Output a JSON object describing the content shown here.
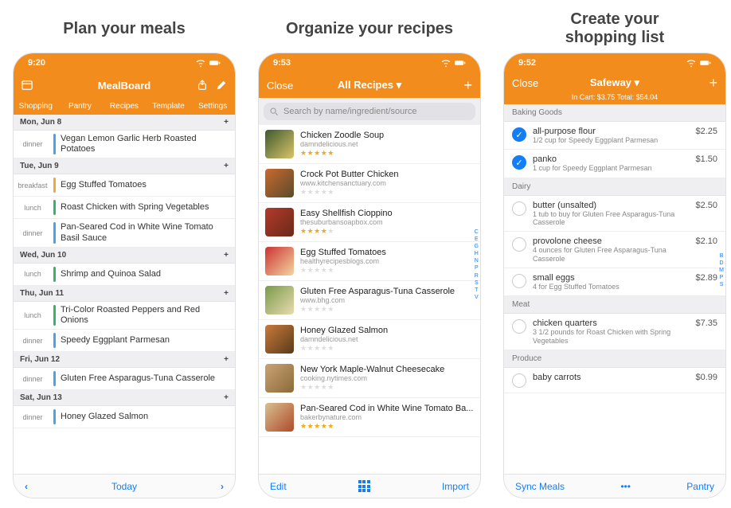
{
  "captions": {
    "plan": "Plan your meals",
    "recipes": "Organize your recipes",
    "shopping": "Create your\nshopping list"
  },
  "status": {
    "plan_time": "9:20",
    "recipes_time": "9:53",
    "shopping_time": "9:52"
  },
  "plan": {
    "nav_title": "MealBoard",
    "tabs": [
      "Shopping",
      "Pantry",
      "Recipes",
      "Template",
      "Settings"
    ],
    "days": [
      {
        "label": "Mon, Jun 8",
        "meals": [
          {
            "slot": "dinner",
            "color": "#4aa3e8",
            "title": "Vegan Lemon Garlic Herb Roasted Potatoes"
          }
        ]
      },
      {
        "label": "Tue, Jun 9",
        "meals": [
          {
            "slot": "breakfast",
            "color": "#f0a83a",
            "title": "Egg Stuffed Tomatoes"
          },
          {
            "slot": "lunch",
            "color": "#39b36a",
            "title": "Roast Chicken with Spring Vegetables"
          },
          {
            "slot": "dinner",
            "color": "#4aa3e8",
            "title": "Pan-Seared Cod in White Wine Tomato Basil Sauce"
          }
        ]
      },
      {
        "label": "Wed, Jun 10",
        "meals": [
          {
            "slot": "lunch",
            "color": "#39b36a",
            "title": "Shrimp and Quinoa Salad"
          }
        ]
      },
      {
        "label": "Thu, Jun 11",
        "meals": [
          {
            "slot": "lunch",
            "color": "#39b36a",
            "title": "Tri-Color Roasted Peppers and Red Onions"
          },
          {
            "slot": "dinner",
            "color": "#4aa3e8",
            "title": "Speedy Eggplant Parmesan"
          }
        ]
      },
      {
        "label": "Fri, Jun 12",
        "meals": [
          {
            "slot": "dinner",
            "color": "#4aa3e8",
            "title": "Gluten Free Asparagus-Tuna Casserole"
          }
        ]
      },
      {
        "label": "Sat, Jun 13",
        "meals": [
          {
            "slot": "dinner",
            "color": "#4aa3e8",
            "title": "Honey Glazed Salmon"
          }
        ]
      }
    ],
    "bottom": {
      "prev": "‹",
      "today": "Today",
      "next": "›"
    }
  },
  "recipes": {
    "close": "Close",
    "title": "All Recipes ▾",
    "plus": "+",
    "search_placeholder": "Search by name/ingredient/source",
    "items": [
      {
        "title": "Chicken Zoodle Soup",
        "source": "damndelicious.net",
        "stars": 5,
        "thumb": "linear-gradient(135deg,#3e5a2f,#d9c46a)"
      },
      {
        "title": "Crock Pot Butter Chicken",
        "source": "www.kitchensanctuary.com",
        "stars": 0,
        "thumb": "linear-gradient(135deg,#c96a2d,#5a4a2d)"
      },
      {
        "title": "Easy Shellfish Cioppino",
        "source": "thesuburbansoapbox.com",
        "stars": 4,
        "thumb": "linear-gradient(135deg,#b33a2a,#6a2a1a)"
      },
      {
        "title": "Egg Stuffed Tomatoes",
        "source": "healthyrecipesblogs.com",
        "stars": 0,
        "thumb": "linear-gradient(135deg,#c33,#f2d6a0)"
      },
      {
        "title": "Gluten Free Asparagus-Tuna Casserole",
        "source": "www.bhg.com",
        "stars": 0,
        "thumb": "linear-gradient(135deg,#7a9a4a,#e8dcb0)"
      },
      {
        "title": "Honey Glazed Salmon",
        "source": "damndelicious.net",
        "stars": 0,
        "thumb": "linear-gradient(135deg,#c97a3a,#5a3a1a)"
      },
      {
        "title": "New York Maple-Walnut Cheesecake",
        "source": "cooking.nytimes.com",
        "stars": 0,
        "thumb": "linear-gradient(135deg,#caa373,#8a6a3a)"
      },
      {
        "title": "Pan-Seared Cod in White Wine Tomato Ba...",
        "source": "bakerbynature.com",
        "stars": 5,
        "thumb": "linear-gradient(135deg,#d8c090,#b04a2a)"
      }
    ],
    "index": [
      "C",
      "E",
      "G",
      "H",
      "N",
      "P",
      "R",
      "S",
      "T",
      "V"
    ],
    "bottom": {
      "left": "Edit",
      "right": "Import"
    }
  },
  "shopping": {
    "close": "Close",
    "title": "Safeway ▾",
    "plus": "+",
    "cart_line": "In Cart: $3.75   Total: $54.04",
    "index": [
      "B",
      "D",
      "M",
      "P",
      "S"
    ],
    "sections": [
      {
        "name": "Baking Goods",
        "items": [
          {
            "checked": true,
            "title": "all-purpose flour",
            "note": "1/2 cup for Speedy Eggplant Parmesan",
            "price": "$2.25"
          },
          {
            "checked": true,
            "title": "panko",
            "note": "1 cup for Speedy Eggplant Parmesan",
            "price": "$1.50"
          }
        ]
      },
      {
        "name": "Dairy",
        "items": [
          {
            "checked": false,
            "title": "butter (unsalted)",
            "note": "1 tub to buy for Gluten Free Asparagus-Tuna Casserole",
            "price": "$2.50"
          },
          {
            "checked": false,
            "title": "provolone cheese",
            "note": "4 ounces for Gluten Free Asparagus-Tuna Casserole",
            "price": "$2.10"
          },
          {
            "checked": false,
            "title": "small eggs",
            "note": "4 for Egg Stuffed Tomatoes",
            "price": "$2.89"
          }
        ]
      },
      {
        "name": "Meat",
        "items": [
          {
            "checked": false,
            "title": "chicken quarters",
            "note": "3 1/2 pounds for Roast Chicken with Spring Vegetables",
            "price": "$7.35"
          }
        ]
      },
      {
        "name": "Produce",
        "items": [
          {
            "checked": false,
            "title": "baby carrots",
            "note": "",
            "price": "$0.99"
          }
        ]
      }
    ],
    "bottom": {
      "left": "Sync Meals",
      "center": "•••",
      "right": "Pantry"
    }
  }
}
